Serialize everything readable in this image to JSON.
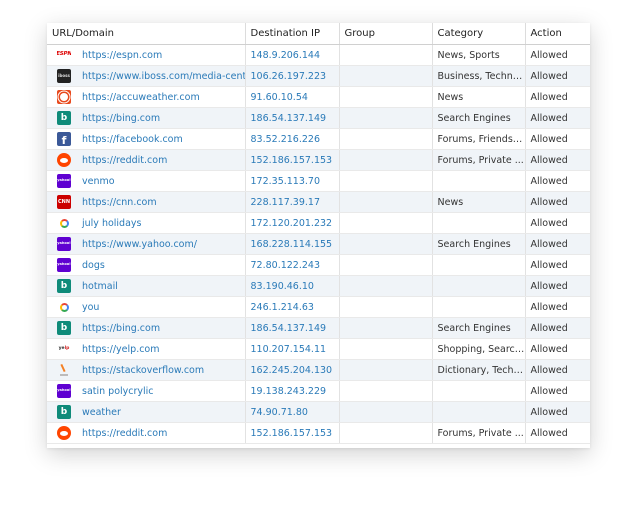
{
  "table": {
    "headers": {
      "url": "URL/Domain",
      "ip": "Destination IP",
      "group": "Group",
      "category": "Category",
      "action": "Action"
    },
    "rows": [
      {
        "icon": "espn-icon",
        "url": "https://espn.com",
        "ip": "148.9.206.144",
        "group": "",
        "category": "News, Sports",
        "action": "Allowed"
      },
      {
        "icon": "iboss-icon",
        "url": "https://www.iboss.com/media-center",
        "ip": "106.26.197.223",
        "group": "",
        "category": "Business, Technol...",
        "action": "Allowed"
      },
      {
        "icon": "accuweather-icon",
        "url": "https://accuweather.com",
        "ip": "91.60.10.54",
        "group": "",
        "category": "News",
        "action": "Allowed"
      },
      {
        "icon": "bing-icon",
        "url": "https://bing.com",
        "ip": "186.54.137.149",
        "group": "",
        "category": "Search Engines",
        "action": "Allowed"
      },
      {
        "icon": "facebook-icon",
        "url": "https://facebook.com",
        "ip": "83.52.216.226",
        "group": "",
        "category": "Forums, Friendship",
        "action": "Allowed"
      },
      {
        "icon": "reddit-icon",
        "url": "https://reddit.com",
        "ip": "152.186.157.153",
        "group": "",
        "category": "Forums, Private ...",
        "action": "Allowed"
      },
      {
        "icon": "yahoo-icon",
        "url": "venmo",
        "ip": "172.35.113.70",
        "group": "",
        "category": "",
        "action": "Allowed"
      },
      {
        "icon": "cnn-icon",
        "url": "https://cnn.com",
        "ip": "228.117.39.17",
        "group": "",
        "category": "News",
        "action": "Allowed"
      },
      {
        "icon": "google-icon",
        "url": "july holidays",
        "ip": "172.120.201.232",
        "group": "",
        "category": "",
        "action": "Allowed"
      },
      {
        "icon": "yahoo-icon",
        "url": "https://www.yahoo.com/",
        "ip": "168.228.114.155",
        "group": "",
        "category": "Search Engines",
        "action": "Allowed"
      },
      {
        "icon": "yahoo-icon",
        "url": "dogs",
        "ip": "72.80.122.243",
        "group": "",
        "category": "",
        "action": "Allowed"
      },
      {
        "icon": "bing-icon",
        "url": "hotmail",
        "ip": "83.190.46.10",
        "group": "",
        "category": "",
        "action": "Allowed"
      },
      {
        "icon": "google-icon",
        "url": "you",
        "ip": "246.1.214.63",
        "group": "",
        "category": "",
        "action": "Allowed"
      },
      {
        "icon": "bing-icon",
        "url": "https://bing.com",
        "ip": "186.54.137.149",
        "group": "",
        "category": "Search Engines",
        "action": "Allowed"
      },
      {
        "icon": "yelp-icon",
        "url": "https://yelp.com",
        "ip": "110.207.154.11",
        "group": "",
        "category": "Shopping, Search ...",
        "action": "Allowed"
      },
      {
        "icon": "stackoverflow-icon",
        "url": "https://stackoverflow.com",
        "ip": "162.245.204.130",
        "group": "",
        "category": "Dictionary, Techn...",
        "action": "Allowed"
      },
      {
        "icon": "yahoo-icon",
        "url": "satin polycrylic",
        "ip": "19.138.243.229",
        "group": "",
        "category": "",
        "action": "Allowed"
      },
      {
        "icon": "bing-icon",
        "url": "weather",
        "ip": "74.90.71.80",
        "group": "",
        "category": "",
        "action": "Allowed"
      },
      {
        "icon": "reddit-icon",
        "url": "https://reddit.com",
        "ip": "152.186.157.153",
        "group": "",
        "category": "Forums, Private ...",
        "action": "Allowed"
      }
    ]
  },
  "colors": {
    "link": "#2a7ab8",
    "row_alt": "#f0f4f8"
  }
}
